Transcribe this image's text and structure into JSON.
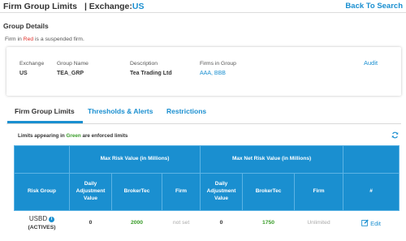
{
  "header": {
    "title": "Firm Group Limits",
    "exchange_label": "| Exchange:",
    "exchange_value": "US",
    "back_link": "Back To Search"
  },
  "group_details": {
    "title": "Group Details",
    "note_prefix": "Firm in",
    "note_red": "Red",
    "note_suffix": "is a suspended firm.",
    "fields": {
      "exchange": {
        "label": "Exchange",
        "value": "US"
      },
      "group_name": {
        "label": "Group Name",
        "value": "TEA_GRP"
      },
      "description": {
        "label": "Description",
        "value": "Tea Trading Ltd"
      },
      "firms": {
        "label": "Firms in Group",
        "value": "AAA, BBB"
      }
    },
    "audit_link": "Audit"
  },
  "tabs": [
    {
      "label": "Firm Group Limits",
      "active": true
    },
    {
      "label": "Thresholds & Alerts",
      "active": false
    },
    {
      "label": "Restrictions",
      "active": false
    }
  ],
  "limits": {
    "note_prefix": "Limits appearing in",
    "note_green": "Green",
    "note_suffix": "are enforced limits",
    "group_headers": {
      "max_risk": "Max Risk Value (in Millions)",
      "max_net_risk": "Max Net Risk Value (in Millions)"
    },
    "columns": {
      "risk_group": "Risk Group",
      "daily_adj_1": "Daily Adjustment Value",
      "brokertec_1": "BrokerTec",
      "firm_1": "Firm",
      "daily_adj_2": "Daily Adjustment Value",
      "brokertec_2": "BrokerTec",
      "firm_2": "Firm",
      "hash": "#"
    },
    "rows": [
      {
        "risk_group": "USBD",
        "risk_group_sub": "(ACTIVES)",
        "daily_adj_1": "0",
        "brokertec_1": "2000",
        "firm_1": "not set",
        "daily_adj_2": "0",
        "brokertec_2": "1750",
        "firm_2": "Unlimited",
        "action": "Edit"
      }
    ]
  },
  "colors": {
    "accent": "#1a8fd0",
    "enforced": "#3a9d2a",
    "suspended": "#e0302a"
  },
  "icons": [
    "info-icon",
    "refresh-icon",
    "edit-icon"
  ]
}
